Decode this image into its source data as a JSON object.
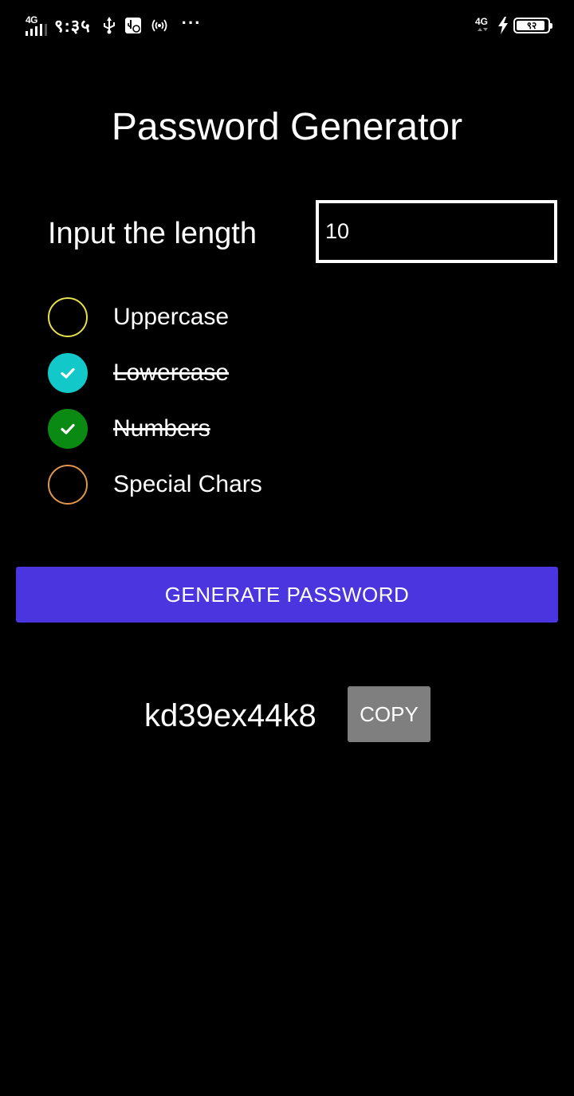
{
  "status_bar": {
    "network_left": "4G",
    "time": "९:३५",
    "network_right": "4G",
    "battery_level": "९२",
    "battery_fraction": 0.92,
    "icons": [
      "signal-icon",
      "usb-icon",
      "usb-debugging-icon",
      "hotspot-icon",
      "more-icon",
      "charging-icon",
      "battery-icon"
    ],
    "more": "···"
  },
  "app": {
    "title": "Password Generator"
  },
  "length": {
    "label": "Input the length",
    "value": "10"
  },
  "options": [
    {
      "label": "Uppercase",
      "checked": false,
      "color": "#e6df4a"
    },
    {
      "label": "Lowercase",
      "checked": true,
      "color": "#13c8c8"
    },
    {
      "label": "Numbers",
      "checked": true,
      "color": "#0b8a13"
    },
    {
      "label": "Special Chars",
      "checked": false,
      "color": "#e0964a"
    }
  ],
  "generate_button": {
    "label": "GENERATE PASSWORD",
    "color": "#4a35de"
  },
  "result": {
    "password": "kd39ex44k8",
    "copy_label": "COPY",
    "copy_color": "#7f7f7f"
  }
}
